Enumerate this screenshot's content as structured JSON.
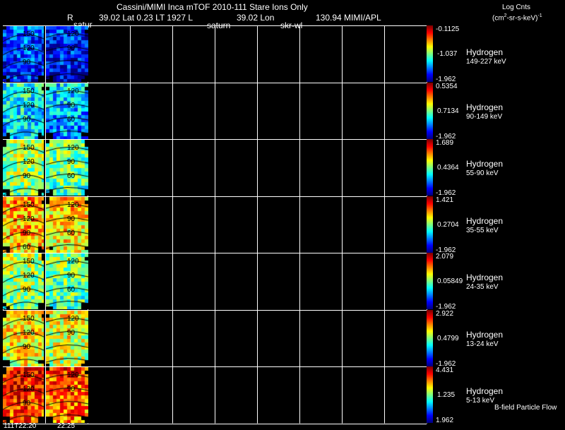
{
  "header": {
    "title": "Cassini/MIMI Inca mTOF  2010-111   Stare   Ions Only",
    "line2_R": "R",
    "line2_lat": "39.02 Lat 0.23 LT 1927 L",
    "line2_lon": "39.02 Lon",
    "line2_mimi": "130.94  MIMI/APL",
    "overlay_satur": "satur",
    "overlay_saturn": "saturn",
    "overlay_skrwl": "skr-wl"
  },
  "units": {
    "line1": "Log Cnts",
    "line2_a": "(cm",
    "line2_sup": "2",
    "line2_b": "-sr-s-keV)",
    "line2_sup2": "-1"
  },
  "footer": {
    "time1": "111T22:20",
    "time2": "22:25",
    "note": "B-field Particle Flow"
  },
  "chart_data": {
    "type": "heatmap",
    "xlabel": "",
    "ylabel": "",
    "panels": [
      {
        "species": "Hydrogen",
        "energy": "149-227 keV",
        "cb_max": "-0.1125",
        "cb_mid": "-1.037",
        "cb_min": "-1.962",
        "contours_left": [
          "150",
          "120",
          "90"
        ],
        "contours_right": [
          "120",
          "90"
        ],
        "level": 0.2
      },
      {
        "species": "Hydrogen",
        "energy": "90-149 keV",
        "cb_max": "0.5354",
        "cb_mid": "0.7134",
        "cb_min": "-1.962",
        "contours_left": [
          "150",
          "120",
          "90"
        ],
        "contours_right": [
          "120",
          "90",
          "60"
        ],
        "level": 0.38
      },
      {
        "species": "Hydrogen",
        "energy": "55-90 keV",
        "cb_max": "1.689",
        "cb_mid": "0.4364",
        "cb_min": "-1.962",
        "contours_left": [
          "150",
          "120",
          "90"
        ],
        "contours_right": [
          "120",
          "90",
          "60"
        ],
        "level": 0.55
      },
      {
        "species": "Hydrogen",
        "energy": "35-55 keV",
        "cb_max": "1.421",
        "cb_mid": "0.2704",
        "cb_min": "-1.962",
        "contours_left": [
          "150",
          "120",
          "90",
          "60"
        ],
        "contours_right": [
          "120",
          "90",
          "60"
        ],
        "level": 0.72
      },
      {
        "species": "Hydrogen",
        "energy": "24-35 keV",
        "cb_max": "2.079",
        "cb_mid": "0.05849",
        "cb_min": "-1.962",
        "contours_left": [
          "150",
          "120",
          "90"
        ],
        "contours_right": [
          "120",
          "90",
          "60"
        ],
        "level": 0.55
      },
      {
        "species": "Hydrogen",
        "energy": "13-24 keV",
        "cb_max": "2.922",
        "cb_mid": "0.4799",
        "cb_min": "-1.962",
        "contours_left": [
          "150",
          "120",
          "90"
        ],
        "contours_right": [
          "120",
          "90"
        ],
        "level": 0.66
      },
      {
        "species": "Hydrogen",
        "energy": "5-13 keV",
        "cb_max": "4.431",
        "cb_mid": "1.235",
        "cb_min": "1.962",
        "contours_left": [
          "150",
          "120",
          "90"
        ],
        "contours_right": [
          "120",
          "90"
        ],
        "level": 0.85
      }
    ]
  }
}
